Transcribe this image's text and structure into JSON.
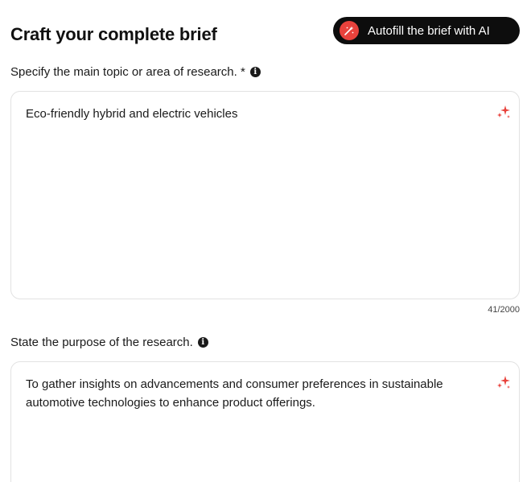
{
  "header": {
    "title": "Craft your complete brief",
    "autofill_label": "Autofill the brief with AI"
  },
  "fields": [
    {
      "label": "Specify the main topic or area of research. *",
      "value": "Eco-friendly hybrid and electric vehicles",
      "counter": "41/2000"
    },
    {
      "label": "State the purpose of the research.",
      "value": "To gather insights on advancements and consumer preferences in sustainable automotive technologies to enhance product offerings."
    }
  ],
  "icons": {
    "info": "info-icon",
    "sparkle": "sparkle-icon",
    "ai_badge": "magic-wand-icon"
  },
  "colors": {
    "accent": "#e8423c",
    "button_bg": "#0d0d0d",
    "border": "#e2e2e2"
  }
}
